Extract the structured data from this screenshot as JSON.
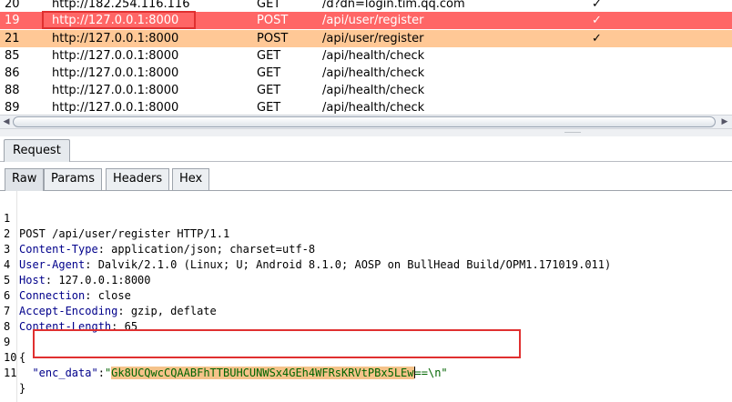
{
  "history": {
    "rows": [
      {
        "num": "20",
        "host": "http://182.254.116.116",
        "method": "GET",
        "url": "/d?dn=login.tim.qq.com",
        "check": "✓",
        "style": "normal"
      },
      {
        "num": "19",
        "host": "http://127.0.0.1:8000",
        "method": "POST",
        "url": "/api/user/register",
        "check": "✓",
        "style": "red"
      },
      {
        "num": "21",
        "host": "http://127.0.0.1:8000",
        "method": "POST",
        "url": "/api/user/register",
        "check": "✓",
        "style": "orange"
      },
      {
        "num": "85",
        "host": "http://127.0.0.1:8000",
        "method": "GET",
        "url": "/api/health/check",
        "check": "",
        "style": "normal"
      },
      {
        "num": "86",
        "host": "http://127.0.0.1:8000",
        "method": "GET",
        "url": "/api/health/check",
        "check": "",
        "style": "normal"
      },
      {
        "num": "88",
        "host": "http://127.0.0.1:8000",
        "method": "GET",
        "url": "/api/health/check",
        "check": "",
        "style": "normal"
      },
      {
        "num": "89",
        "host": "http://127.0.0.1:8000",
        "method": "GET",
        "url": "/api/health/check",
        "check": "",
        "style": "normal"
      }
    ]
  },
  "colors": {
    "selected_row": "#ff6666",
    "highlighted_row": "#ffc896",
    "annotation_box": "#e03030"
  },
  "request_tab": {
    "label": "Request"
  },
  "inner_tabs": {
    "raw": "Raw",
    "params": "Params",
    "headers": "Headers",
    "hex": "Hex"
  },
  "request": {
    "request_line": "POST /api/user/register HTTP/1.1",
    "headers": [
      {
        "key": "Content-Type",
        "value": " application/json; charset=utf-8"
      },
      {
        "key": "User-Agent",
        "value": " Dalvik/2.1.0 (Linux; U; Android 8.1.0; AOSP on BullHead Build/OPM1.171019.011)"
      },
      {
        "key": "Host",
        "value": " 127.0.0.1:8000"
      },
      {
        "key": "Connection",
        "value": " close"
      },
      {
        "key": "Accept-Encoding",
        "value": " gzip, deflate"
      },
      {
        "key": "Content-Length",
        "value": " 65"
      }
    ],
    "body": {
      "open_brace": "{",
      "indent": "  ",
      "key": "\"enc_data\"",
      "colon": ":",
      "quote_open": "\"",
      "selected_value": "Gk8UCQwcCQAABFhTTBUHCUNWSx4GEh4WFRsKRVtPBx5LEw",
      "rest_value": "==\\n",
      "quote_close": "\"",
      "close_brace": "}"
    },
    "line_numbers": [
      "1",
      "2",
      "3",
      "4",
      "5",
      "6",
      "7",
      "8",
      "9",
      "10",
      "11"
    ]
  }
}
